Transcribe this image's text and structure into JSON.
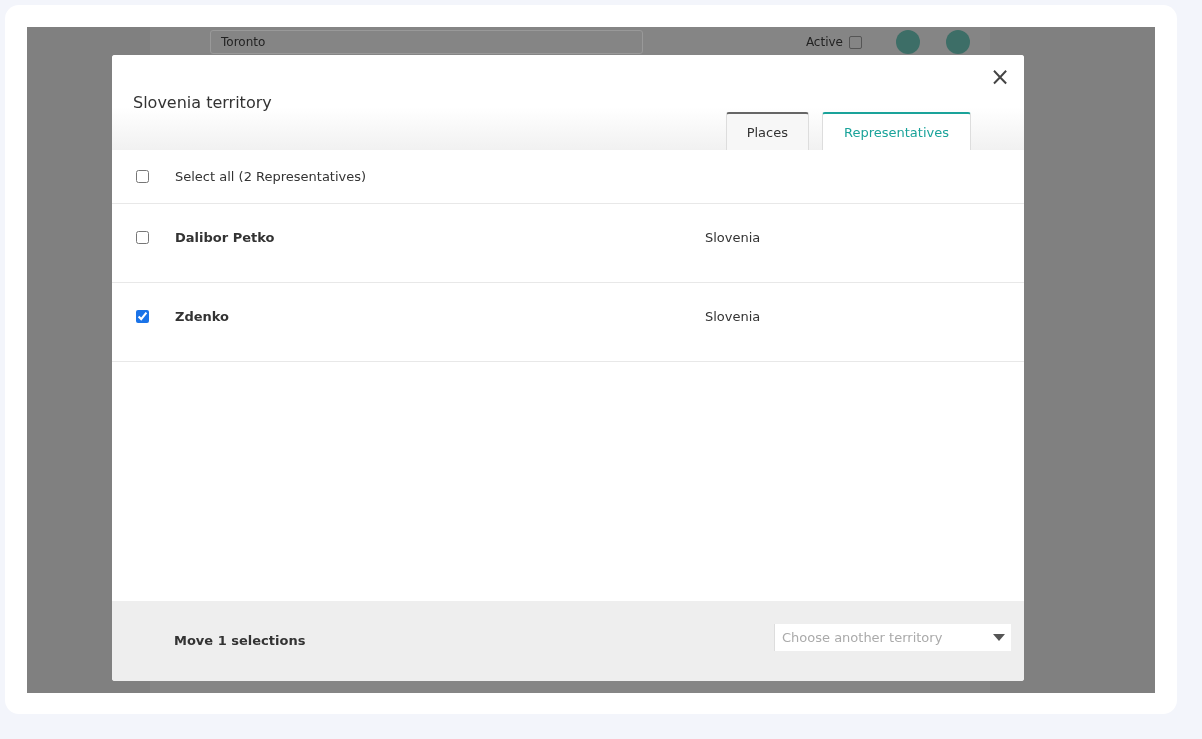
{
  "background": {
    "search_value": "Toronto",
    "active_label": "Active",
    "active_checked": false
  },
  "dialog": {
    "title": "Slovenia territory",
    "close": "×",
    "tabs": [
      {
        "label": "Places",
        "selected": false
      },
      {
        "label": "Representatives",
        "selected": true
      }
    ],
    "select_all": {
      "label": "Select all (2 Representatives)",
      "checked": false
    },
    "rows": [
      {
        "name": "Dalibor Petko",
        "country": "Slovenia",
        "checked": false
      },
      {
        "name": "Zdenko",
        "country": "Slovenia",
        "checked": true
      }
    ],
    "footer": {
      "summary": "Move 1 selections",
      "territory": {
        "placeholder": "Choose another territory"
      }
    }
  }
}
